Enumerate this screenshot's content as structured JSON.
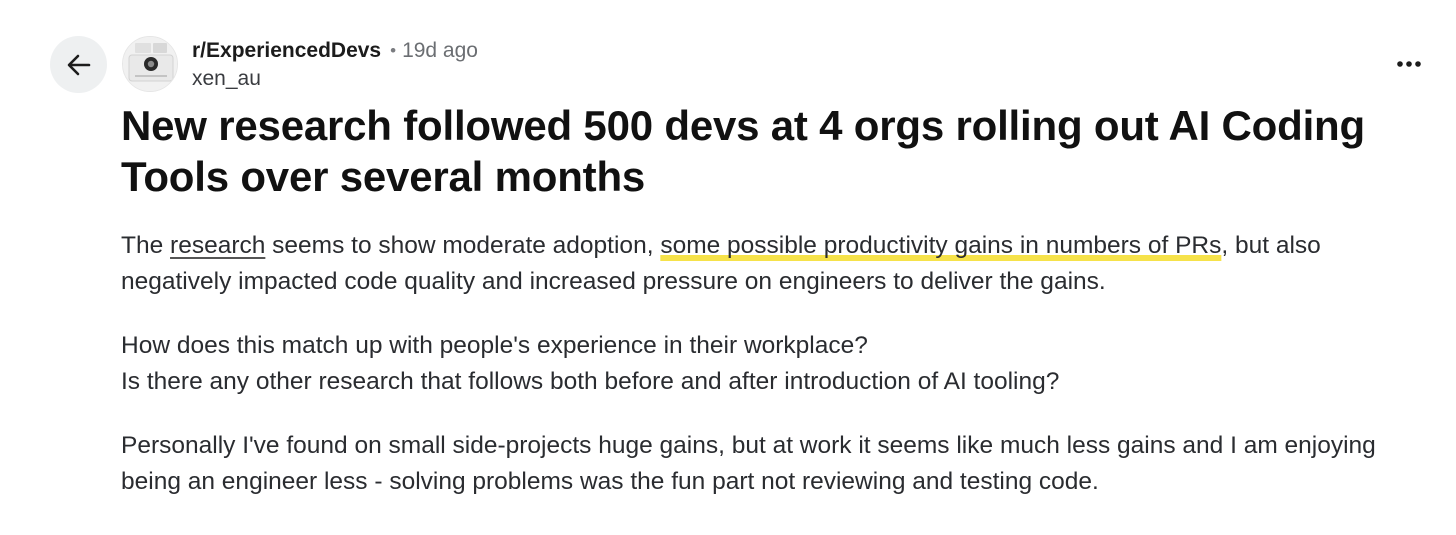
{
  "header": {
    "subreddit": "r/ExperiencedDevs",
    "separator": "•",
    "time_ago": "19d ago",
    "username": "xen_au"
  },
  "post": {
    "title": "New research followed 500 devs at 4 orgs rolling out AI Coding Tools over several months",
    "p1": {
      "prefix": "The ",
      "link_text": "research",
      "middle": " seems to show moderate adoption, ",
      "highlighted": "some possible productivity gains in numbers of PRs",
      "suffix": ", but also negatively impacted code quality and increased pressure on engineers to deliver the gains."
    },
    "p2": {
      "line1": "How does this match up with people's experience in their workplace?",
      "line2": "Is there any other research that follows both before and after introduction of AI tooling?"
    },
    "p3": "Personally I've found on small side-projects huge gains, but at work it seems like much less gains and I am enjoying being an engineer less - solving problems was the fun part not reviewing and testing code."
  },
  "icons": {
    "back": "arrow-left-icon",
    "more": "more-horizontal-icon",
    "avatar": "subreddit-avatar-icon"
  },
  "colors": {
    "highlight": "#f6e24a",
    "back_button_bg": "#eef0f1",
    "text": "#2a2c30"
  }
}
